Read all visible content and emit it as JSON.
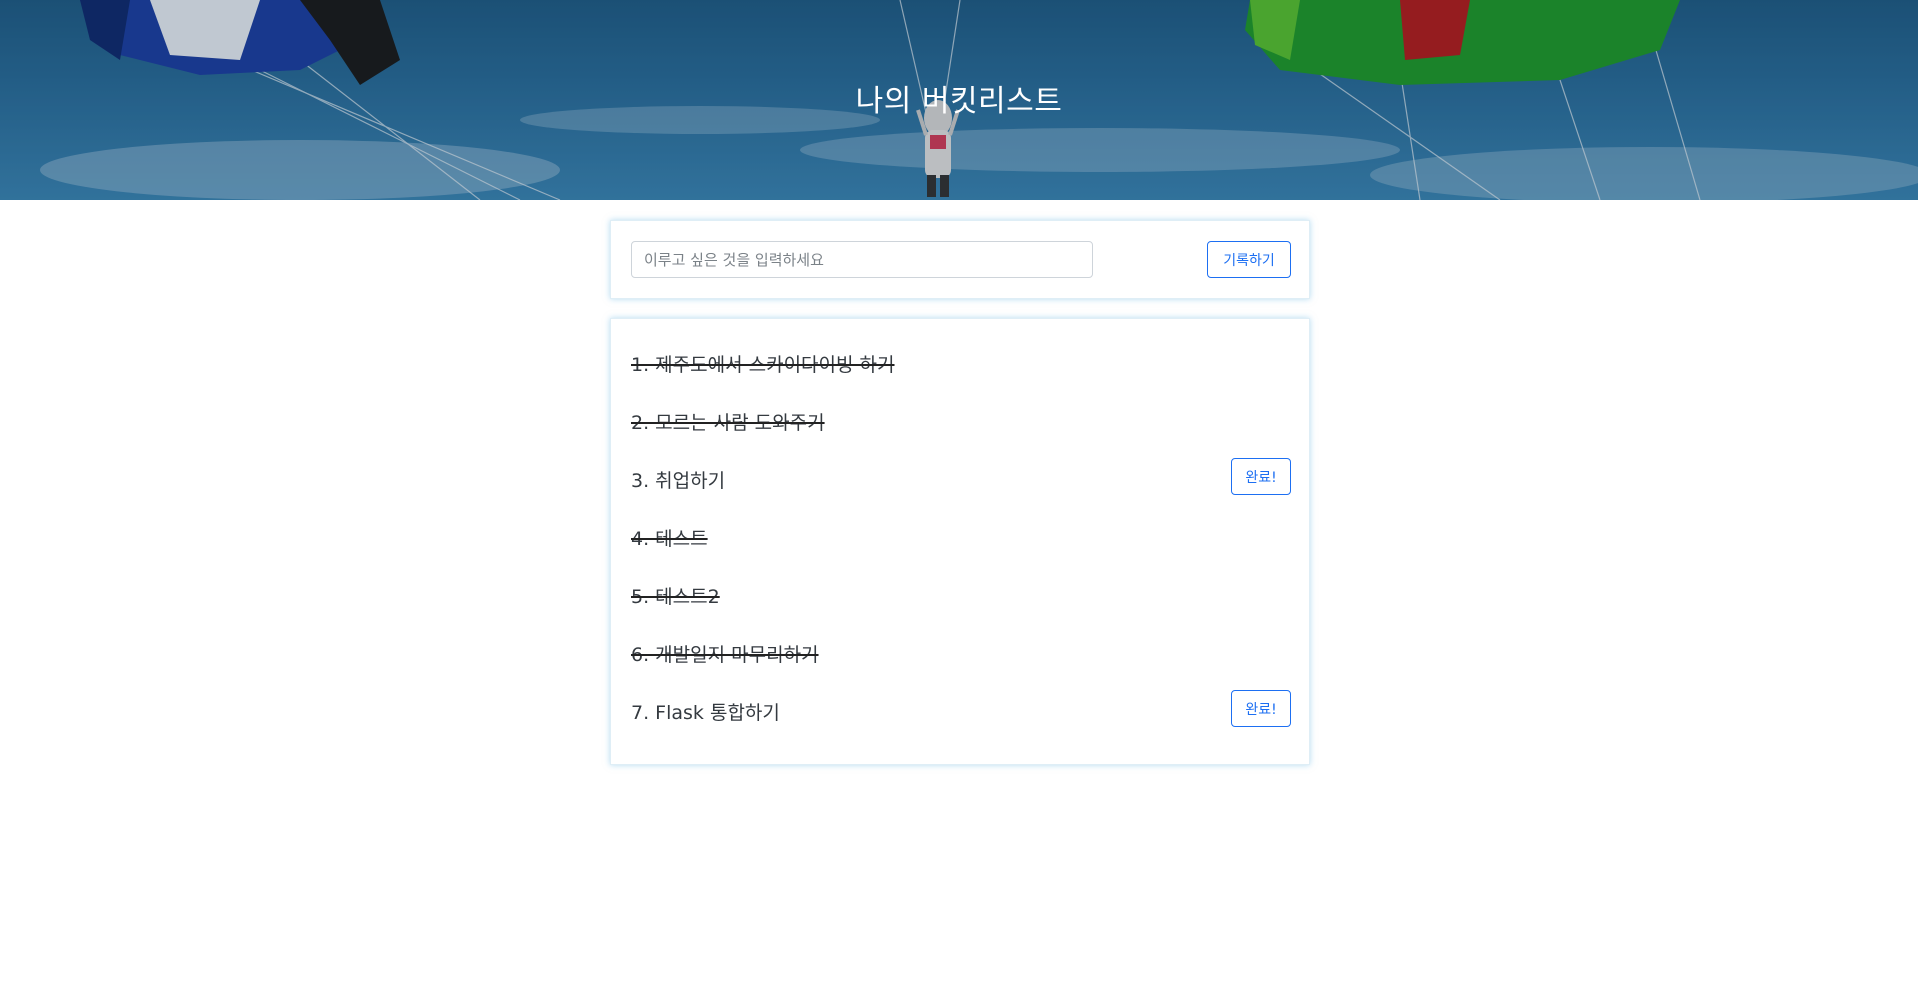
{
  "header": {
    "title": "나의 버킷리스트"
  },
  "form": {
    "input_placeholder": "이루고 싶은 것을 입력하세요",
    "input_value": "",
    "submit_label": "기록하기"
  },
  "list": {
    "items": [
      {
        "text": "1. 제주도에서 스카이다이빙 하기",
        "done": true
      },
      {
        "text": "2. 모르는 사람 도와주기",
        "done": true
      },
      {
        "text": "3. 취업하기",
        "done": false,
        "button_label": "완료!"
      },
      {
        "text": "4. 테스트",
        "done": true
      },
      {
        "text": "5. 테스트2",
        "done": true
      },
      {
        "text": "6. 개발일지 마무리하기",
        "done": true
      },
      {
        "text": "7. Flask 통합하기",
        "done": false,
        "button_label": "완료!"
      }
    ]
  },
  "colors": {
    "accent": "#1d6ff2",
    "done_strike": "#222222"
  }
}
